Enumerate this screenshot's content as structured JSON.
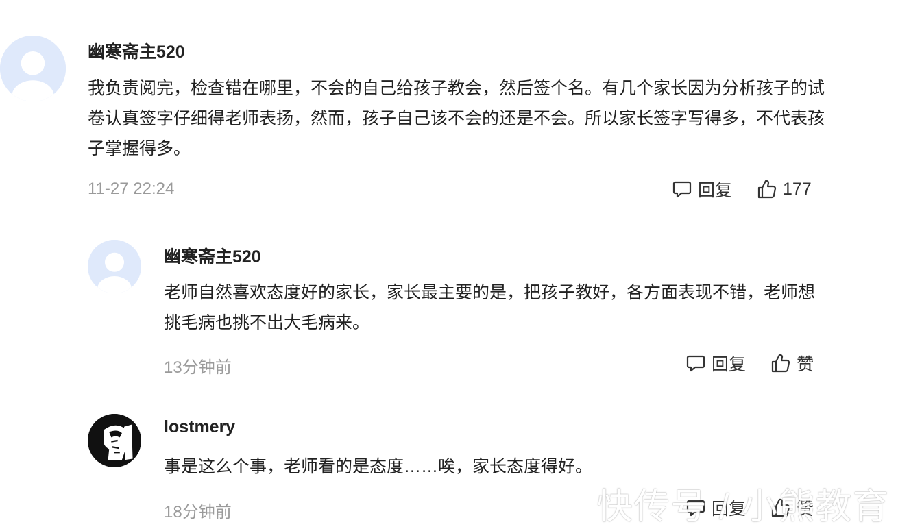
{
  "comments": [
    {
      "username": "幽寒斋主520",
      "text": "我负责阅完，检查错在哪里，不会的自己给孩子教会，然后签个名。有几个家长因为分析孩子的试卷认真签字仔细得老师表扬，然而，孩子自己该不会的还是不会。所以家长签字写得多，不代表孩子掌握得多。",
      "time": "11-27 22:24",
      "reply_label": "回复",
      "like_label": "177",
      "avatar": "default-avatar"
    },
    {
      "username": "幽寒斋主520",
      "text": "老师自然喜欢态度好的家长，家长最主要的是，把孩子教好，各方面表现不错，老师想挑毛病也挑不出大毛病来。",
      "time": "13分钟前",
      "reply_label": "回复",
      "like_label": "赞",
      "avatar": "default-avatar"
    },
    {
      "username": "lostmery",
      "text": "事是这么个事，老师看的是态度……唉，家长态度得好。",
      "time": "18分钟前",
      "reply_label": "回复",
      "like_label": "赞",
      "avatar": "profile-sketch-avatar"
    }
  ],
  "watermark": "快传号 / 小熊教育",
  "colors": {
    "text": "#222222",
    "muted": "#9a9a9a",
    "avatar_bg": "#dfe9fb"
  }
}
